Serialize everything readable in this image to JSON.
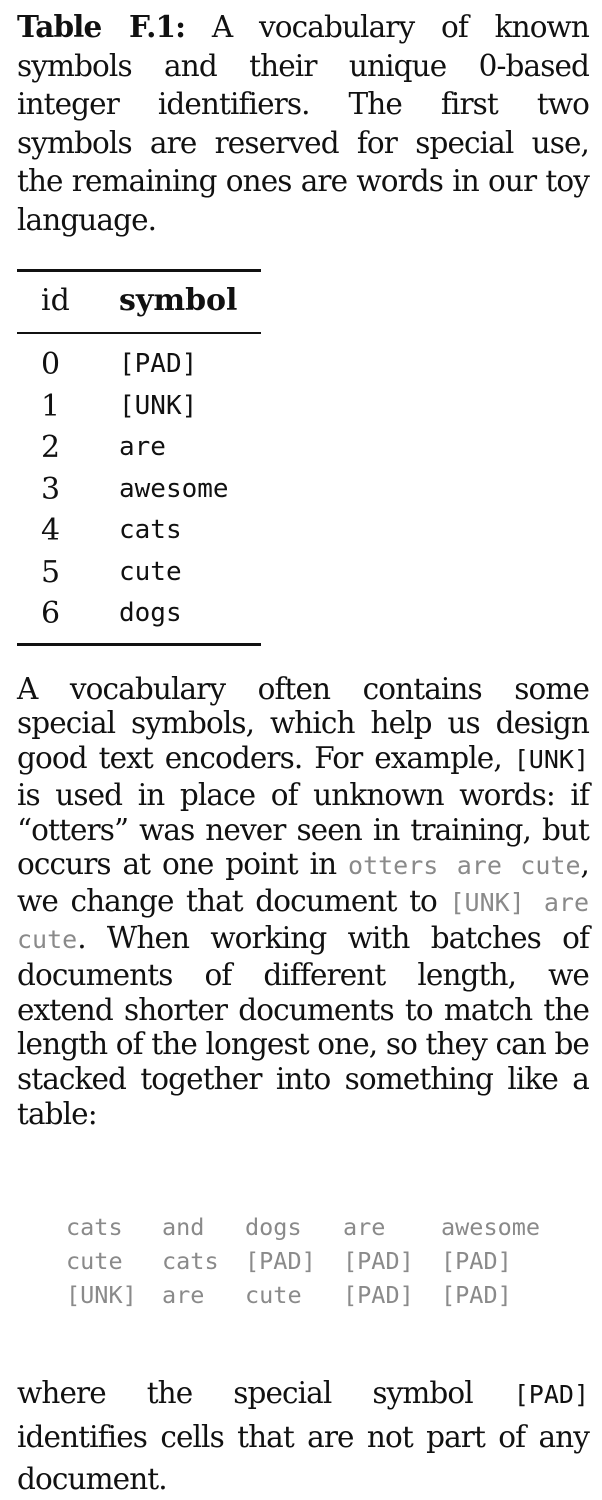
{
  "caption": {
    "label": "Table F.1:",
    "text": "A vocabulary of known symbols and their unique 0-based integer identifiers. The first two symbols are reserved for special use, the remaining ones are words in our toy language."
  },
  "vocab_table": {
    "headers": {
      "id": "id",
      "symbol": "symbol"
    },
    "rows": [
      {
        "id": "0",
        "symbol": "[PAD]"
      },
      {
        "id": "1",
        "symbol": "[UNK]"
      },
      {
        "id": "2",
        "symbol": "are"
      },
      {
        "id": "3",
        "symbol": "awesome"
      },
      {
        "id": "4",
        "symbol": "cats"
      },
      {
        "id": "5",
        "symbol": "cute"
      },
      {
        "id": "6",
        "symbol": "dogs"
      }
    ]
  },
  "paragraph1": {
    "part1": "A vocabulary often contains some special symbols, which help us design good text encoders. For example, ",
    "code_unk": "[UNK]",
    "part2": " is used in place of unknown words: if “otters” was never seen in training, but occurs at one point in ",
    "code_example1": "otters are cute",
    "part3": ", we change that document to ",
    "code_example2": "[UNK] are cute",
    "part4": ". When working with batches of documents of different length, we extend shorter documents to match the length of the longest one, so they can be stacked together into something like a table:"
  },
  "batch_grid": {
    "rows": [
      [
        "cats",
        "and",
        "dogs",
        "are",
        "awesome"
      ],
      [
        "cute",
        "cats",
        "[PAD]",
        "[PAD]",
        "[PAD]"
      ],
      [
        "[UNK]",
        "are",
        "cute",
        "[PAD]",
        "[PAD]"
      ]
    ]
  },
  "paragraph2": {
    "part1": "where the special symbol ",
    "code_pad": "[PAD]",
    "part2": " identifies cells that are not part of any document."
  }
}
